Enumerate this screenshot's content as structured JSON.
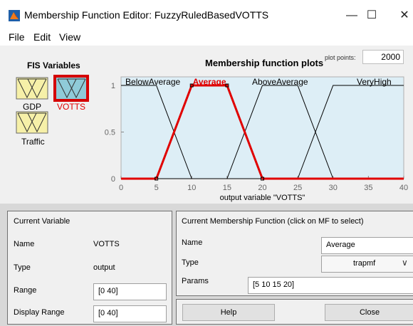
{
  "window": {
    "title": "Membership Function Editor: FuzzyRuledBasedVOTTS",
    "minimize_glyph": "—",
    "maximize_glyph": "☐",
    "close_glyph": "✕"
  },
  "menu": {
    "items": [
      "File",
      "Edit",
      "View"
    ]
  },
  "fis": {
    "heading": "FIS Variables",
    "variables": [
      {
        "label": "GDP",
        "selected": false
      },
      {
        "label": "VOTTS",
        "selected": true
      },
      {
        "label": "Traffic",
        "selected": false
      }
    ]
  },
  "plot": {
    "title": "Membership function plots",
    "plot_points_label": "plot points:",
    "plot_points_value": "2000"
  },
  "chart_data": {
    "type": "line",
    "xlabel": "output variable \"VOTTS\"",
    "xlim": [
      0,
      40
    ],
    "ylim": [
      0,
      1
    ],
    "xticks": [
      "0",
      "5",
      "10",
      "15",
      "20",
      "25",
      "30",
      "35",
      "40"
    ],
    "yticks": [
      "0",
      "0.5",
      "1"
    ],
    "series": [
      {
        "name": "BelowAverage",
        "shape": "trapmf",
        "x": [
          0,
          0,
          5,
          10
        ],
        "y": [
          1,
          1,
          1,
          0
        ],
        "color": "#000000",
        "selected": false
      },
      {
        "name": "Average",
        "shape": "trapmf",
        "x": [
          5,
          10,
          15,
          20
        ],
        "y": [
          0,
          1,
          1,
          0
        ],
        "color": "#e00000",
        "selected": true
      },
      {
        "name": "AboveAverage",
        "shape": "trapmf",
        "x": [
          15,
          20,
          25,
          30
        ],
        "y": [
          0,
          1,
          1,
          0
        ],
        "color": "#000000",
        "selected": false
      },
      {
        "name": "VeryHigh",
        "shape": "trapmf",
        "x": [
          25,
          30,
          40,
          40
        ],
        "y": [
          0,
          1,
          1,
          1
        ],
        "color": "#000000",
        "selected": false
      }
    ]
  },
  "current_variable": {
    "heading": "Current Variable",
    "name_label": "Name",
    "name_value": "VOTTS",
    "type_label": "Type",
    "type_value": "output",
    "range_label": "Range",
    "range_value": "[0 40]",
    "display_range_label": "Display Range",
    "display_range_value": "[0 40]"
  },
  "current_mf": {
    "heading": "Current Membership Function (click on MF to select)",
    "name_label": "Name",
    "name_value": "Average",
    "type_label": "Type",
    "type_value": "trapmf",
    "params_label": "Params",
    "params_value": "[5 10 15 20]"
  },
  "buttons": {
    "help": "Help",
    "close": "Close"
  },
  "colors": {
    "axes_bg": "#ddeef6",
    "icon_fill": "#f6f0a8",
    "icon_selected_fill": "#8fcbd8",
    "selected_border": "#d40000",
    "selected_label": "#e00000"
  }
}
